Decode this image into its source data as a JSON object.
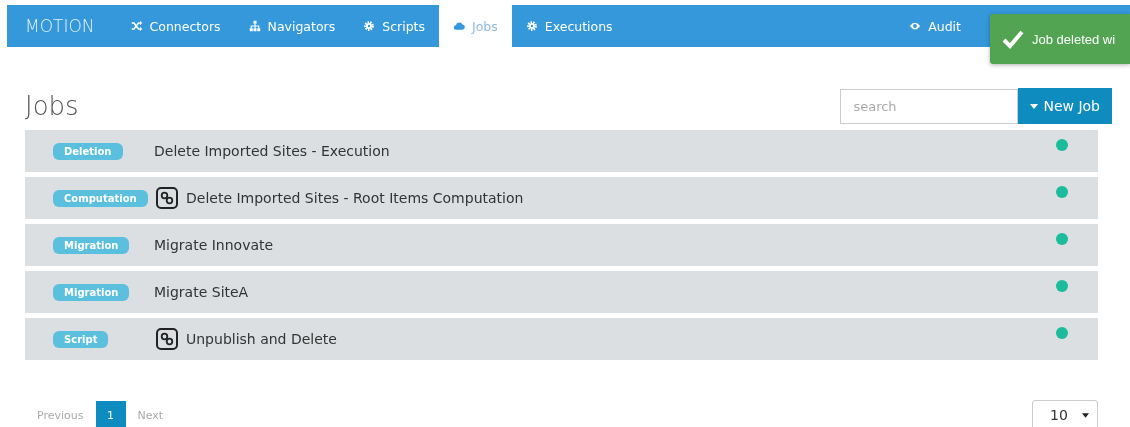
{
  "nav": {
    "brand": "MOTION",
    "tabs": [
      {
        "label": "Connectors",
        "selected": false
      },
      {
        "label": "Navigators",
        "selected": false
      },
      {
        "label": "Scripts",
        "selected": false
      },
      {
        "label": "Jobs",
        "selected": true
      },
      {
        "label": "Executions",
        "selected": false
      }
    ],
    "right": {
      "label": "Audit"
    }
  },
  "toast": {
    "text": "Job deleted wi"
  },
  "page": {
    "title": "Jobs",
    "search": {
      "placeholder": "search"
    },
    "new_button": "New Job"
  },
  "jobs": [
    {
      "type": "Deletion",
      "name": "Delete Imported Sites - Execution",
      "linked": false,
      "color": "#1abc9c"
    },
    {
      "type": "Computation",
      "name": "Delete Imported Sites - Root Items Computation",
      "linked": true,
      "color": "#1abc9c"
    },
    {
      "type": "Migration",
      "name": "Migrate Innovate",
      "linked": false,
      "color": "#1abc9c"
    },
    {
      "type": "Migration",
      "name": "Migrate SiteA",
      "linked": false,
      "color": "#1abc9c"
    },
    {
      "type": "Script",
      "name": "Unpublish and Delete",
      "linked": true,
      "color": "#1abc9c"
    }
  ],
  "pagination": {
    "previous": "Previous",
    "pages": [
      {
        "label": "1",
        "selected": true
      }
    ],
    "next": "Next",
    "page_size": "10"
  }
}
